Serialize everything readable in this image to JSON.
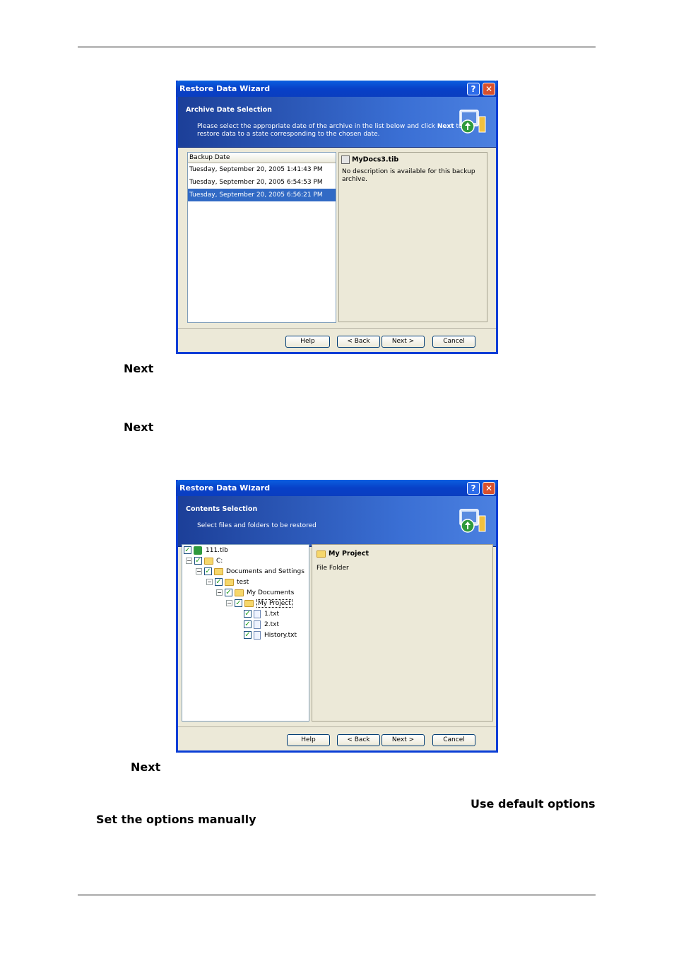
{
  "page": {
    "next_label_1": "Next",
    "next_label_2": "Next",
    "next_label_3": "Next",
    "use_default_options": "Use default options",
    "set_options_manually": "Set the options manually"
  },
  "dialog1": {
    "title": "Restore Data Wizard",
    "header_title": "Archive Date Selection",
    "header_desc_a": "Please select the appropriate date of the archive in the list below and click ",
    "header_desc_bold": "Next",
    "header_desc_b": " to restore data to a state corresponding to the chosen date.",
    "column_header": "Backup Date",
    "dates": [
      "Tuesday, September 20, 2005 1:41:43 PM",
      "Tuesday, September 20, 2005 6:54:53 PM",
      "Tuesday, September 20, 2005 6:56:21 PM"
    ],
    "selected_index": 2,
    "archive_name": "MyDocs3.tib",
    "archive_desc": "No description is available for this backup archive.",
    "buttons": {
      "help": "Help",
      "back": "< Back",
      "next": "Next >",
      "cancel": "Cancel"
    }
  },
  "dialog2": {
    "title": "Restore Data Wizard",
    "header_title": "Contents Selection",
    "header_desc": "Select files and folders to be restored",
    "tree": {
      "root": "111.tib",
      "drive": "C:",
      "folder1": "Documents and Settings",
      "folder2": "test",
      "folder3": "My Documents",
      "folder4": "My Project",
      "file1": "1.txt",
      "file2": "2.txt",
      "file3": "History.txt"
    },
    "info_name": "My Project",
    "info_type": "File Folder",
    "buttons": {
      "help": "Help",
      "back": "< Back",
      "next": "Next >",
      "cancel": "Cancel"
    }
  }
}
